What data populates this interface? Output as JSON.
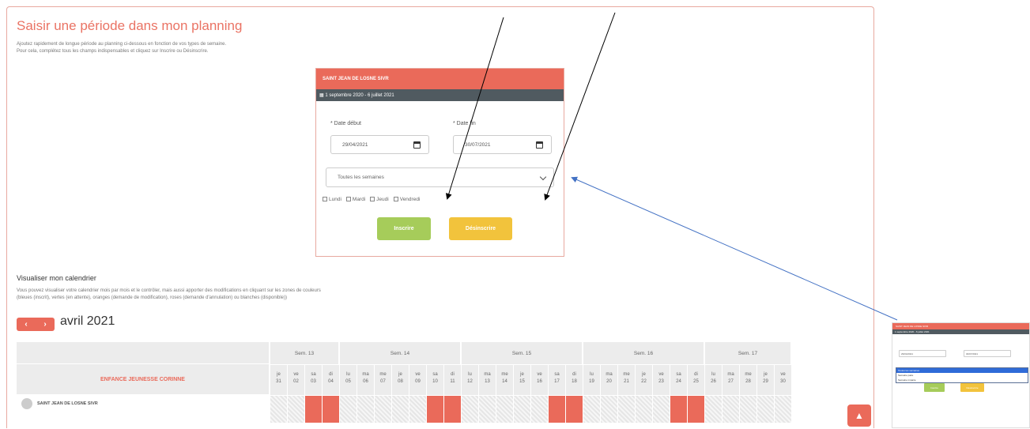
{
  "page": {
    "title": "Saisir une période dans mon planning",
    "intro_line1": "Ajoutez rapidement de longue période au planning ci-dessous en fonction de vos types de semaine.",
    "intro_line2": "Pour cela, complétez tous les champs indispensables et cliquez sur Inscrire ou Désinscrire."
  },
  "form": {
    "site_name": "SAINT JEAN DE LOSNE SIVR",
    "period": "1 septembre 2020 - 6 juillet 2021",
    "date_debut_label": "* Date début",
    "date_fin_label": "* Date fin",
    "date_debut_value": "29/04/2021",
    "date_fin_value": "30/07/2021",
    "week_type_value": "Toutes les semaines",
    "days": [
      "Lundi",
      "Mardi",
      "Jeudi",
      "Vendredi"
    ],
    "inscrire_label": "Inscrire",
    "desinscrire_label": "Désinscrire"
  },
  "calendar": {
    "title": "Visualiser mon calendrier",
    "text_line1": "Vous pouvez visualiser votre calendrier mois par mois et le contrôler, mais aussi apporter des modifications en cliquant sur les zones de couleurs",
    "text_line2": "(bleues (inscrit), vertes (en attente), oranges (demande de modification), roses (demande d'annulation) ou blanches (disponible))",
    "prev_label": "‹",
    "next_label": "›",
    "month": "avril 2021",
    "group_label": "ENFANCE JEUNESSE CORINNE",
    "row_label": "SAINT JEAN DE LOSNE SIVR",
    "weeks": [
      "Sem. 13",
      "Sem. 14",
      "Sem. 15",
      "Sem. 16",
      "Sem. 17"
    ],
    "day_abbr": [
      "je",
      "ve",
      "sa",
      "di",
      "lu",
      "ma",
      "me",
      "je",
      "ve",
      "sa",
      "di",
      "lu",
      "ma",
      "me",
      "je",
      "ve",
      "sa",
      "di",
      "lu",
      "ma",
      "me",
      "je",
      "ve",
      "sa",
      "di",
      "lu",
      "ma",
      "me",
      "je",
      "ve"
    ],
    "day_num": [
      "31",
      "02",
      "03",
      "04",
      "05",
      "06",
      "07",
      "08",
      "09",
      "10",
      "11",
      "12",
      "13",
      "14",
      "15",
      "16",
      "17",
      "18",
      "19",
      "20",
      "21",
      "22",
      "23",
      "24",
      "25",
      "26",
      "27",
      "28",
      "29",
      "30"
    ],
    "red_days": [
      2,
      3,
      9,
      10,
      16,
      17,
      23,
      24
    ],
    "scroll_top_label": "▲"
  },
  "thumbnail": {
    "site_name": "SAINT JEAN DE LOSNE SIVR",
    "period": "1 septembre 2020 - 6 juillet 2021",
    "options": [
      "Toutes les semaines",
      "Semaine paire",
      "Semaine impaire"
    ],
    "inscrire_label": "Inscrire",
    "desinscrire_label": "Désinscrire"
  },
  "colors": {
    "accent": "#ea6a5a",
    "green": "#a6cc5a",
    "orange": "#f2c33c",
    "arrow_blue": "#4472c4"
  }
}
